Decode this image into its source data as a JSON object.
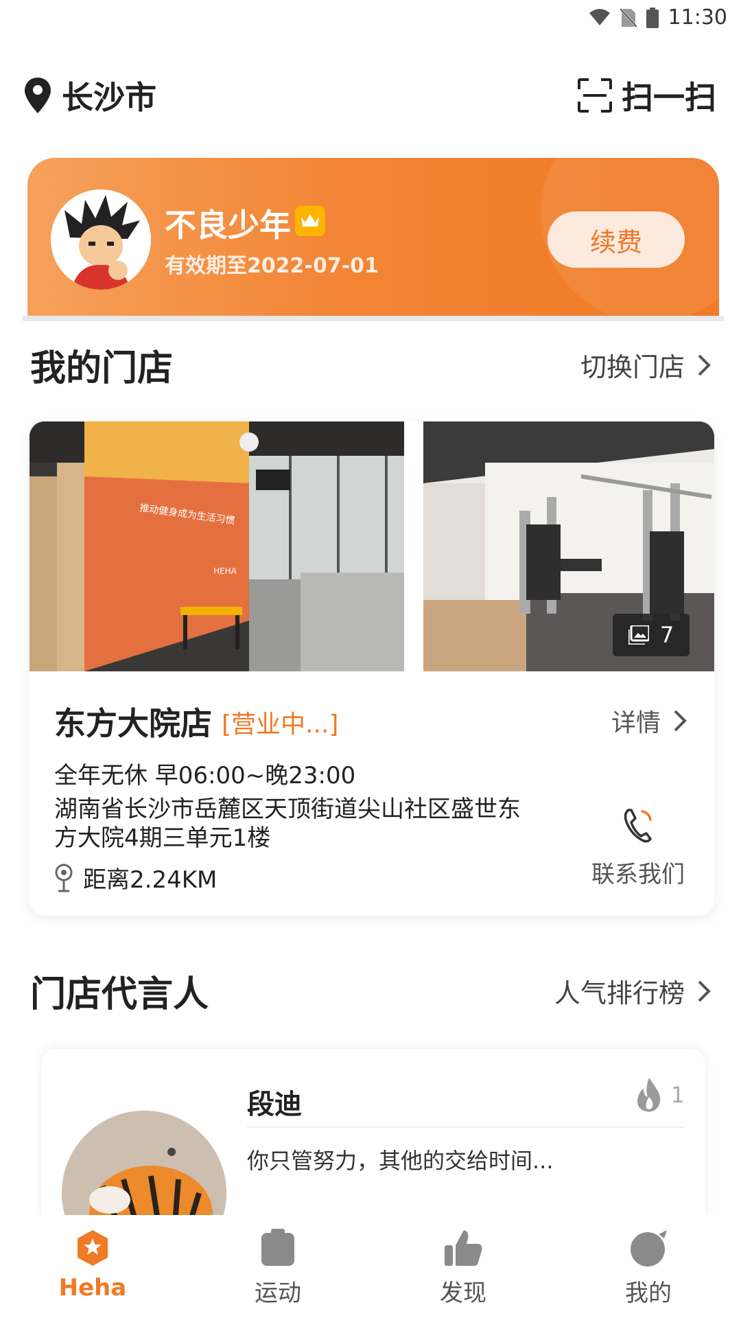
{
  "status_bar": {
    "time": "11:30"
  },
  "header": {
    "city": "长沙市",
    "scan_label": "扫一扫"
  },
  "member": {
    "name": "不良少年",
    "expire": "有效期至2022-07-01",
    "renew_label": "续费"
  },
  "my_store": {
    "title": "我的门店",
    "switch_label": "切换门店",
    "photo_count": "7",
    "name": "东方大院店",
    "status": "[营业中...]",
    "detail_label": "详情",
    "hours": "全年无休 早06:00~晚23:00",
    "address": "湖南省长沙市岳麓区天顶街道尖山社区盛世东方大院4期三单元1楼",
    "distance": "距离2.24KM",
    "contact_label": "联系我们",
    "wall_text": "推动健身成为生活习惯",
    "wall_logo": "HEHA"
  },
  "ambassador": {
    "title": "门店代言人",
    "ranking_label": "人气排行榜",
    "name": "段迪",
    "heat": "1",
    "quote": "你只管努力，其他的交给时间..."
  },
  "nav": [
    {
      "label": "Heha",
      "icon": "heha-star-icon",
      "active": true
    },
    {
      "label": "运动",
      "icon": "clipboard-icon",
      "active": false
    },
    {
      "label": "发现",
      "icon": "thumbs-up-icon",
      "active": false
    },
    {
      "label": "我的",
      "icon": "profile-icon",
      "active": false
    }
  ],
  "colors": {
    "accent": "#f07a25",
    "card_gradient_start": "#f6a15b",
    "card_gradient_end": "#f07a25"
  }
}
